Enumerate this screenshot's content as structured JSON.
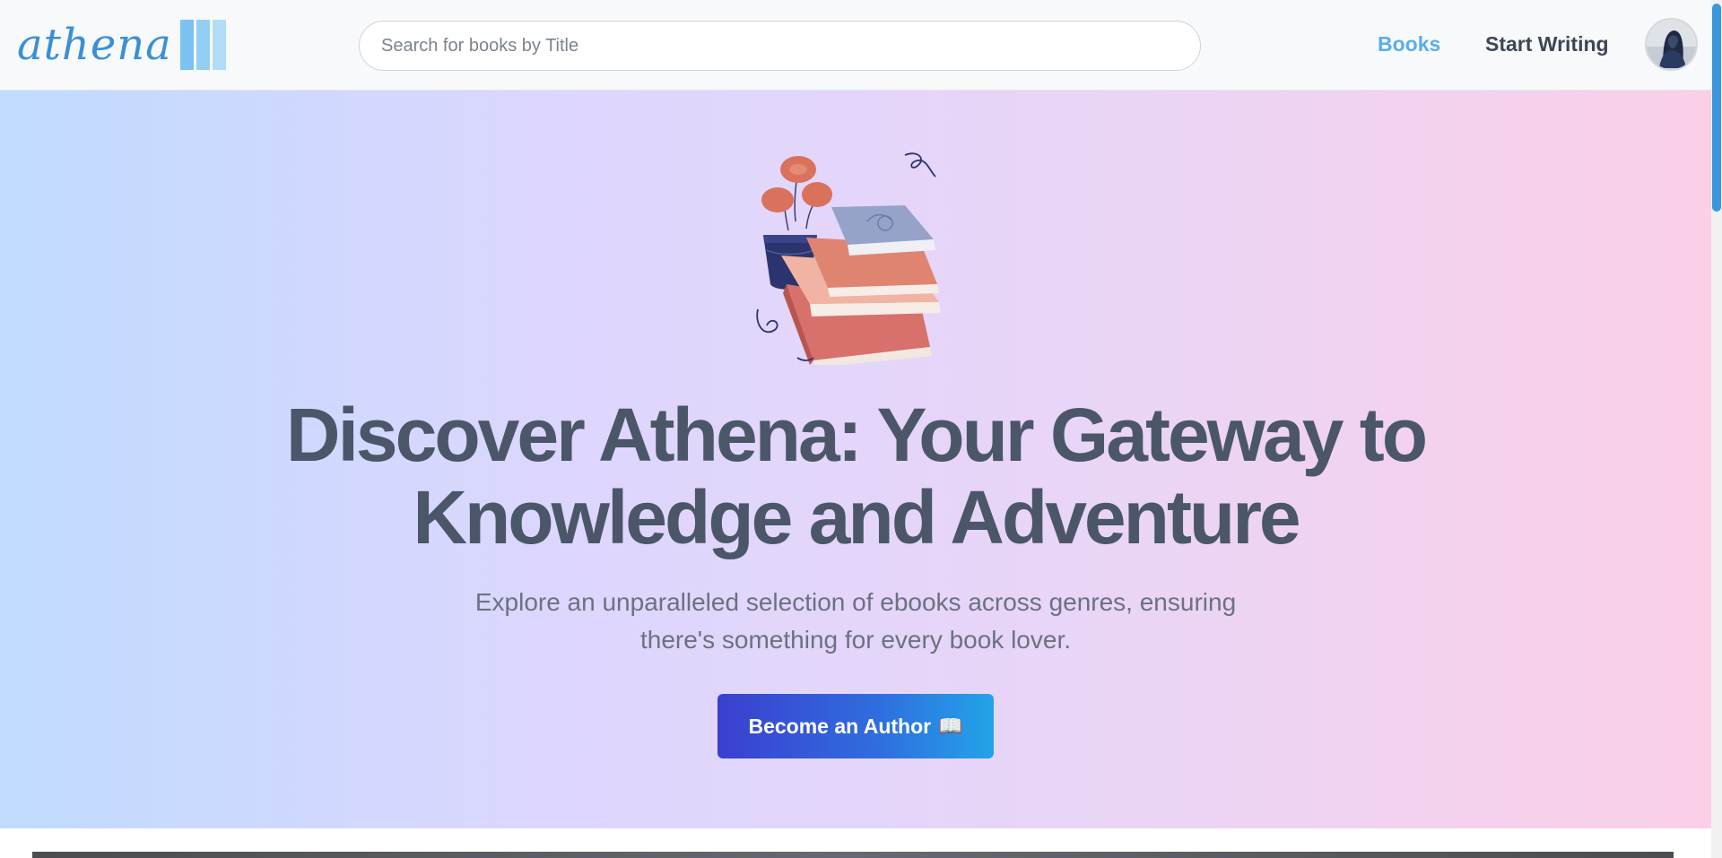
{
  "header": {
    "brand": "athena",
    "brand_bar_colors": [
      "#7cc2f0",
      "#93cff3",
      "#b2dcf7"
    ],
    "search_placeholder": "Search for books by Title",
    "search_value": "",
    "nav": {
      "books": "Books",
      "start_writing": "Start Writing"
    }
  },
  "hero": {
    "headline_line1": "Discover Athena: Your Gateway to",
    "headline_line2": "Knowledge and Adventure",
    "subtitle_line1": "Explore an unparalleled selection of ebooks across genres, ensuring",
    "subtitle_line2": "there's something for every book lover.",
    "cta_label": "Become an Author",
    "cta_icon": "📖"
  },
  "colors": {
    "accent": "#5aaee9",
    "headline": "#4b5669",
    "cta_start": "#3b3fcf",
    "cta_end": "#22a4e8"
  },
  "icons": {
    "avatar": "user-avatar",
    "illustration": "book-stack-with-plant-illustration",
    "cta_icon": "open-book-icon"
  }
}
